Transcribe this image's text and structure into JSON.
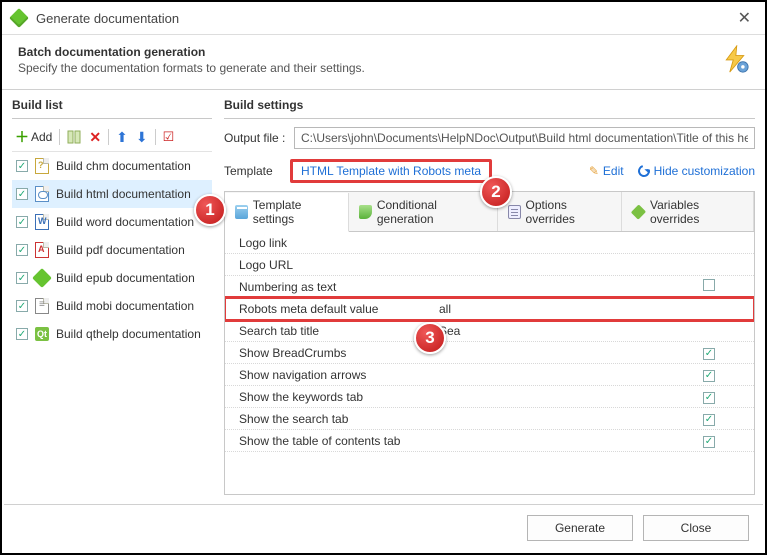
{
  "window": {
    "title": "Generate documentation"
  },
  "header": {
    "title": "Batch documentation generation",
    "subtitle": "Specify the documentation formats to generate and their settings."
  },
  "buildlist": {
    "title": "Build list",
    "add_label": "Add",
    "items": [
      {
        "label": "Build chm documentation",
        "type": "chm"
      },
      {
        "label": "Build html documentation",
        "type": "html"
      },
      {
        "label": "Build word documentation",
        "type": "word"
      },
      {
        "label": "Build pdf documentation",
        "type": "pdf"
      },
      {
        "label": "Build epub documentation",
        "type": "epub"
      },
      {
        "label": "Build mobi documentation",
        "type": "mobi"
      },
      {
        "label": "Build qthelp documentation",
        "type": "qt"
      }
    ]
  },
  "settings": {
    "title": "Build settings",
    "output_label": "Output file :",
    "output_value": "C:\\Users\\john\\Documents\\HelpNDoc\\Output\\Build html documentation\\Title of this help p…",
    "template_label": "Template",
    "template_name": "HTML Template with Robots meta",
    "edit_label": "Edit",
    "hide_label": "Hide customization",
    "tabs": {
      "template": "Template settings",
      "conditional": "Conditional generation",
      "options": "Options overrides",
      "variables": "Variables overrides"
    },
    "rows": {
      "logo_link": "Logo link",
      "logo_url": "Logo URL",
      "numbering": "Numbering as text",
      "robots": "Robots meta default value",
      "robots_val": "all",
      "search_title": "Search tab title",
      "search_title_val": "Sea",
      "breadcrumbs": "Show BreadCrumbs",
      "navarrows": "Show navigation arrows",
      "keywords": "Show the keywords tab",
      "searchtab": "Show the search tab",
      "toctab": "Show the table of contents tab"
    }
  },
  "footer": {
    "generate": "Generate",
    "close": "Close"
  },
  "callouts": {
    "c1": "1",
    "c2": "2",
    "c3": "3"
  }
}
